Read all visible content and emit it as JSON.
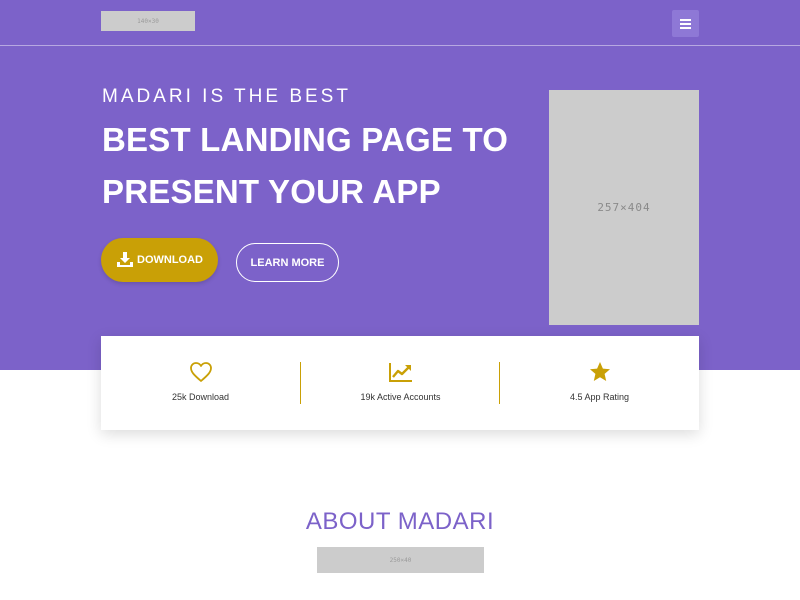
{
  "header": {
    "logo_placeholder": "140×30",
    "menu_icon": "hamburger-icon"
  },
  "hero": {
    "eyebrow": "MADARI IS THE BEST",
    "headline_line1": "BEST LANDING PAGE TO",
    "headline_line2": "PRESENT YOUR APP",
    "download_label": "DOWNLOAD",
    "download_icon": "download-tray-icon",
    "learn_more_label": "LEARN MORE",
    "phone_placeholder": "257×404"
  },
  "stats": [
    {
      "icon": "heart-icon",
      "label": "25k Download"
    },
    {
      "icon": "trending-up-icon",
      "label": "19k Active Accounts"
    },
    {
      "icon": "star-icon",
      "label": "4.5 App Rating"
    }
  ],
  "about": {
    "title": "ABOUT MADARI",
    "placeholder": "250×40"
  },
  "colors": {
    "primary": "#7c62c9",
    "accent": "#c9a006",
    "placeholder": "#cccccc"
  }
}
